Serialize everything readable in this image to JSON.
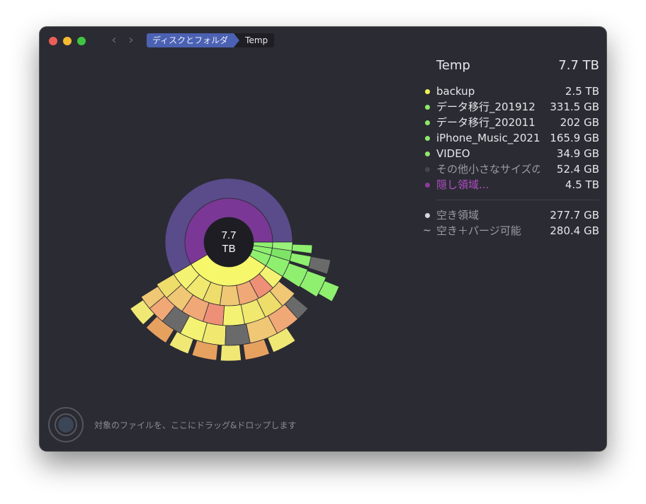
{
  "breadcrumb": [
    "ディスクとフォルダ",
    "Temp"
  ],
  "panel": {
    "title": "Temp",
    "total": "7.7 TB",
    "items": [
      {
        "name": "backup",
        "value": "2.5  TB",
        "color": "#f2f25a"
      },
      {
        "name": "データ移行_201912",
        "value": "331.5 GB",
        "color": "#8ee86a"
      },
      {
        "name": "データ移行_202011",
        "value": "202    GB",
        "color": "#8ee86a"
      },
      {
        "name": "iPhone_Music_2021",
        "value": "165.9 GB",
        "color": "#8ee86a"
      },
      {
        "name": "VIDEO",
        "value": "34.9 GB",
        "color": "#8ee86a"
      },
      {
        "name": "その他小さなサイズの",
        "value": "52.4 GB",
        "color": "#45454c"
      },
      {
        "name": "隠し領域...",
        "value": "4.5  TB",
        "color": "#8a3a9c"
      }
    ],
    "free": {
      "name": "空き領域",
      "value": "277.7 GB"
    },
    "purgeable": {
      "name": "空き＋パージ可能",
      "value": "280.4 GB"
    }
  },
  "center": {
    "line1": "7.7",
    "line2": "TB"
  },
  "drop_hint": "対象のファイルを、ここにドラッグ&ドロップします",
  "sunburst": {
    "ring1": [
      {
        "name": "hidden",
        "share": 0.5844,
        "color": "#7b3796"
      },
      {
        "name": "backup",
        "share": 0.3247,
        "color": "#f6f76a"
      },
      {
        "name": "migration-201912",
        "share": 0.043,
        "color": "#8ff06f"
      },
      {
        "name": "migration-202011",
        "share": 0.0262,
        "color": "#8ff06f"
      },
      {
        "name": "music",
        "share": 0.0215,
        "color": "#8ff06f"
      }
    ]
  }
}
